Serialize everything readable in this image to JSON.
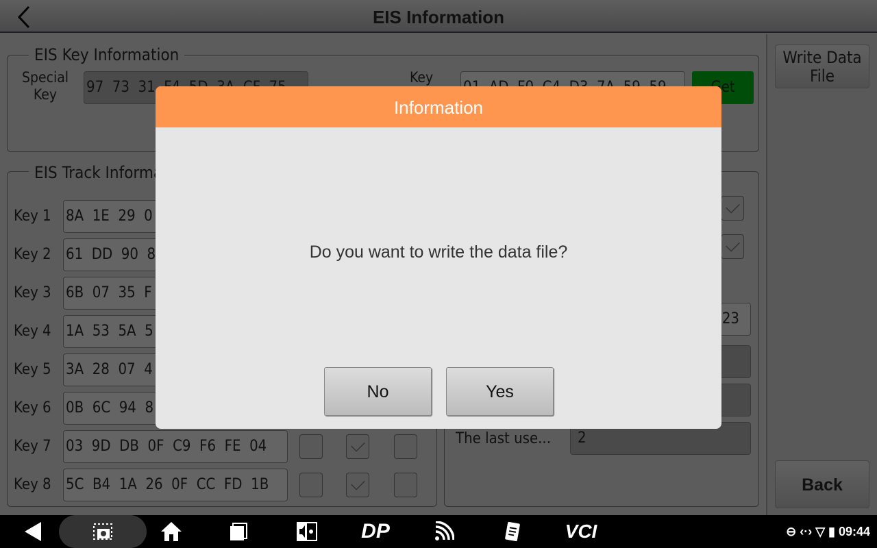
{
  "header": {
    "title": "EIS Information"
  },
  "key_info": {
    "legend": "EIS Key Information",
    "special_key_label": "Special\nKey",
    "special_key_value": "97  73  31  F4  5D  3A  CF  75",
    "key_label": "Key",
    "key_value": "01  AD  F0  C4  D3  7A  59  59",
    "get_button": "Get",
    "get_color": "#004d0a"
  },
  "track_info": {
    "legend": "EIS Track Information",
    "rows": [
      {
        "label": "Key 1",
        "value": "8A  1E  29  0"
      },
      {
        "label": "Key 2",
        "value": "61  DD  90  8"
      },
      {
        "label": "Key 3",
        "value": "6B  07  35  F"
      },
      {
        "label": "Key 4",
        "value": "1A  53  5A  5"
      },
      {
        "label": "Key 5",
        "value": "3A  28  07  4"
      },
      {
        "label": "Key 6",
        "value": "0B  6C  94  8"
      },
      {
        "label": "Key 7",
        "value": "03  9D  DB  0F  C9  F6  FE  04",
        "checks": [
          false,
          true,
          false
        ]
      },
      {
        "label": "Key 8",
        "value": "5C  B4  1A  26  0F  CC  FD  1B",
        "checks": [
          false,
          true,
          false
        ]
      }
    ]
  },
  "right_panel": {
    "check1": true,
    "check2": true,
    "field1_value": "23",
    "last_used_label": "The last use...",
    "last_used_value": "2"
  },
  "sidebar": {
    "write_data_file": "Write Data\nFile",
    "back": "Back"
  },
  "dialog": {
    "title": "Information",
    "message": "Do you want to write the data file?",
    "no": "No",
    "yes": "Yes",
    "header_color": "#ff9650"
  },
  "taskbar": {
    "time": "09:44",
    "icons": [
      "back-icon",
      "screenshot-icon",
      "home-icon",
      "recent-apps-icon",
      "brightness-volume-icon",
      "dp-icon",
      "wireless-icon",
      "notes-icon",
      "vci-icon"
    ],
    "vci_label": "VCI",
    "dp_label": "DP"
  }
}
